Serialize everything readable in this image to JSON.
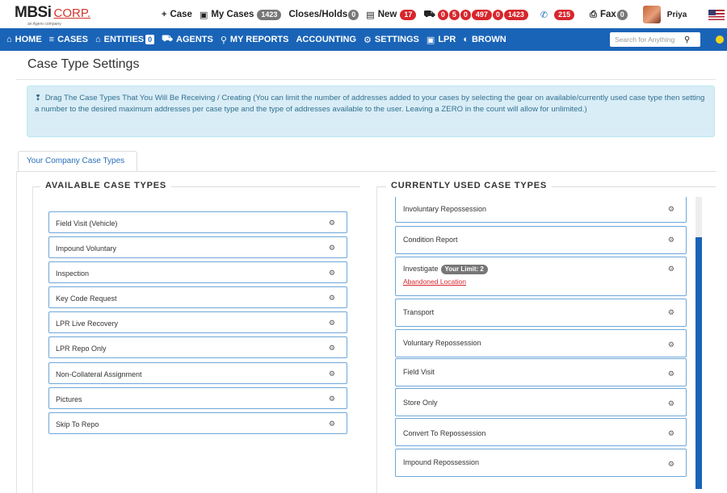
{
  "brand": {
    "name": "MBSi",
    "suffix": "CORP.",
    "tagline": "an Agero company"
  },
  "topnav": {
    "case_label": "Case",
    "my_cases_label": "My Cases",
    "my_cases_count": "1423",
    "closes_label": "Closes/Holds",
    "closes_count": "0",
    "new_label": "New",
    "new_count": "17",
    "truck_counts": [
      "0",
      "5",
      "0",
      "497",
      "0",
      "1423"
    ],
    "calls_count": "215",
    "fax_label": "Fax",
    "fax_count": "0",
    "user_name": "Priya"
  },
  "mainnav": {
    "home": "HOME",
    "cases": "CASES",
    "entities": "ENTITIES",
    "entities_count": "0",
    "agents": "AGENTS",
    "my_reports": "MY REPORTS",
    "accounting": "ACCOUNTING",
    "settings": "SETTINGS",
    "lpr": "LPR",
    "brown": "BROWN",
    "search_placeholder": "Search for Anything"
  },
  "page": {
    "title": "Case Type Settings",
    "info_text": "Drag The Case Types That You Will Be Receiving / Creating (You can limit the number of addresses added to your cases by selecting the gear on available/currently used case type then setting a number to the desired maximum addresses per case type and the type of addresses available to the user. Leaving a ZERO in the count will allow for unlimited.)",
    "tab_label": "Your Company Case Types"
  },
  "available": {
    "heading": "AVAILABLE CASE TYPES",
    "items": [
      "Field Visit (Vehicle)",
      "Impound Voluntary",
      "Inspection",
      "Key Code Request",
      "LPR Live Recovery",
      "LPR Repo Only",
      "Non-Collateral Assignment",
      "Pictures",
      "Skip To Repo"
    ]
  },
  "current": {
    "heading": "CURRENTLY USED CASE TYPES",
    "items": [
      "Involuntary Repossession",
      "Condition Report",
      "Investigate",
      "Transport",
      "Voluntary Repossession",
      "Field Visit",
      "Store Only",
      "Convert To Repossession",
      "Impound Repossession"
    ],
    "investigate_limit": "Your Limit: 2",
    "investigate_address": "Abandoned Location"
  },
  "colors": {
    "nav_blue": "#1a64b8",
    "badge_red": "#d7262c",
    "info_bg": "#d9edf7"
  }
}
